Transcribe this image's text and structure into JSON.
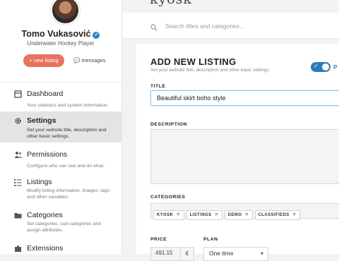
{
  "app": {
    "brand": "kyosk"
  },
  "user": {
    "name": "Tomo Vukasović",
    "role": "Underwater Hockey Player"
  },
  "sidebar": {
    "new_listing_label": "+ new listing",
    "messages_label": "messages",
    "items": [
      {
        "title": "Dashboard",
        "desc": "Your statistics and system information.",
        "icon": "dashboard-icon",
        "active": false
      },
      {
        "title": "Settings",
        "desc": "Set your website title, description and other basic settings.",
        "icon": "gear-icon",
        "active": true
      },
      {
        "title": "Permissions",
        "desc": "Configure who can see and do what.",
        "icon": "users-icon",
        "active": false
      },
      {
        "title": "Listings",
        "desc": "Modify listing information, images, tags and other variables.",
        "icon": "list-icon",
        "active": false
      },
      {
        "title": "Categories",
        "desc": "Set categories, sub-categories and assign attributes.",
        "icon": "folder-icon",
        "active": false
      },
      {
        "title": "Extensions",
        "desc": "",
        "icon": "puzzle-icon",
        "active": false
      }
    ]
  },
  "search": {
    "placeholder": "Search titles and categories..."
  },
  "form": {
    "heading": "ADD NEW LISTING",
    "subheading": "Set your website title, description and other basic settings.",
    "toggle_label": "P",
    "title_label": "TITLE",
    "title_value": "Beautiful skirt boho style",
    "description_label": "DESCRIPTION",
    "categories_label": "CATEGORIES",
    "categories": [
      "KYOSK",
      "LISTINGS",
      "DEMO",
      "CLASSIFIEDS"
    ],
    "price_label": "PRICE",
    "price_value": "491.15",
    "price_currency": "€",
    "plan_label": "PLAN",
    "plan_value": "One time"
  },
  "colors": {
    "accent": "#e8725f",
    "primary": "#2f7bb8",
    "active_bg": "#e4e4e4"
  }
}
